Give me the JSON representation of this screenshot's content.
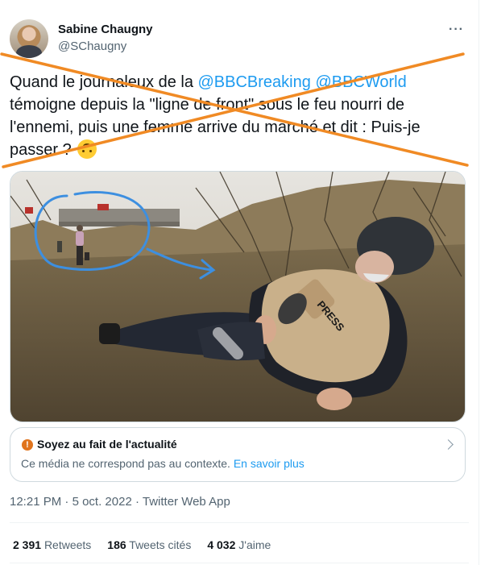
{
  "author": {
    "name": "Sabine Chaugny",
    "handle": "@SChaugny",
    "more_label": "···"
  },
  "tweet": {
    "text_part1": "Quand le journaleux de la ",
    "mention1": "@BBCBreaking",
    "text_space": " ",
    "mention2": "@BBCWorld",
    "text_part2": " témoigne depuis la \"ligne de front\" sous le feu nourri de l'ennemi, puis une femme arrive du marché et dit : Puis-je passer ? ",
    "emoji": "upside-down-face-emoji",
    "strike_color": "#f08a24"
  },
  "media": {
    "vest_label": "PRESS",
    "circle_color": "#3d8fe0"
  },
  "notice": {
    "title": "Soyez au fait de l'actualité",
    "body": "Ce média ne correspond pas au contexte.",
    "link": "En savoir plus",
    "icon": "alert-circle-icon"
  },
  "meta": {
    "time": "12:21 PM",
    "sep1": " · ",
    "date": "5 oct. 2022",
    "sep2": " · ",
    "source": "Twitter Web App"
  },
  "stats": {
    "retweets_count": "2 391",
    "retweets_label": "Retweets",
    "quotes_count": "186",
    "quotes_label": "Tweets cités",
    "likes_count": "4 032",
    "likes_label": "J'aime"
  }
}
